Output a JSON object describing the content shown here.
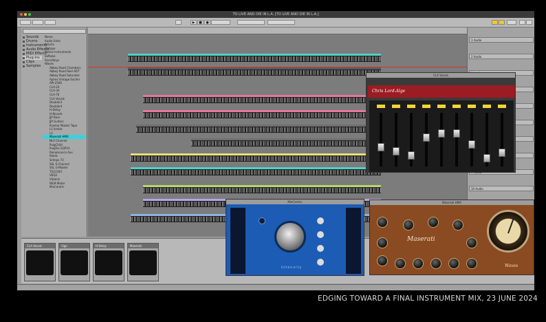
{
  "window": {
    "title": "TO LIVE AND DIE IN L.A. [TO LIVE AND DIE IN L.A.]"
  },
  "caption": "EDGING TOWARD A FINAL INSTRUMENT MIX, 23 JUNE 2024",
  "browser": {
    "search_placeholder": "Search",
    "places": [
      {
        "label": "Sounds",
        "icon": "speaker-icon"
      },
      {
        "label": "Drums",
        "icon": "drum-icon"
      },
      {
        "label": "Instruments",
        "icon": "keys-icon"
      },
      {
        "label": "Audio Effects",
        "icon": "fx-icon"
      },
      {
        "label": "MIDI Effects",
        "icon": "midi-icon"
      },
      {
        "label": "Plug-ins",
        "icon": "plug-icon",
        "selected": true
      },
      {
        "label": "Clips",
        "icon": "clip-icon"
      },
      {
        "label": "Samples",
        "icon": "sample-icon"
      }
    ],
    "files": [
      "Name",
      "Audio Units",
      "Arturia",
      "iZotope",
      "Native Instruments",
      "Softube",
      "Soundtoys",
      "Waves",
      "Abbey Road Chambers",
      "Abbey Road Reel ADT",
      "Abbey Road Saturator",
      "Aphex Vintage Exciter",
      "API-2500",
      "CLA-2A",
      "CLA-3A",
      "CLA-76",
      "CLA Vocals",
      "Doubler2",
      "Doubler4",
      "H-Delay",
      "H-Reverb",
      "JJP Bass",
      "JJP Guitars",
      "Kramer Master Tape",
      "L1 limiter",
      "L2",
      "Maserati HMX",
      "NLS Channel",
      "PuigChild",
      "PuigTec EQP1A",
      "Renaissance Axx",
      "RVerb",
      "Scheps 73",
      "SSL E-Channel",
      "SSL G-Master",
      "TG12345",
      "VEQ4",
      "Vitamin",
      "WLM Meter",
      "MixCentric"
    ],
    "selected_file_index": 26
  },
  "mixer": {
    "tracks": [
      "1 Audio",
      "2 Audio",
      "3 Audio",
      "4 Audio",
      "5 Audio",
      "6 Audio",
      "7 Audio",
      "8 Audio",
      "9 Audio",
      "10 Audio",
      "11 Audio",
      "12 Audio"
    ]
  },
  "devices": [
    {
      "name": "CLA Vocals"
    },
    {
      "name": "Vigo"
    },
    {
      "name": "H-Delay"
    },
    {
      "name": "Maserati"
    }
  ],
  "plugins": {
    "cla": {
      "title": "Chris Lord-Alge",
      "window_title": "CLA Vocals"
    },
    "puig": {
      "title": "Intensity",
      "window_title": "MixCentric"
    },
    "maserati": {
      "title": "Maserati",
      "window_title": "Maserati HMX",
      "brand": "Waves"
    }
  },
  "colors": {
    "clip_cyan": "#4fd1c6",
    "clip_pink": "#e8779b",
    "clip_yellow": "#e9e178",
    "clip_lime": "#b7d86a",
    "clip_lavender": "#b5a6e4",
    "clip_blue": "#8fb3e6",
    "cla_red": "#9b1c22",
    "puig_blue": "#1c5cb4",
    "maserati_wood": "#8a4a22"
  }
}
